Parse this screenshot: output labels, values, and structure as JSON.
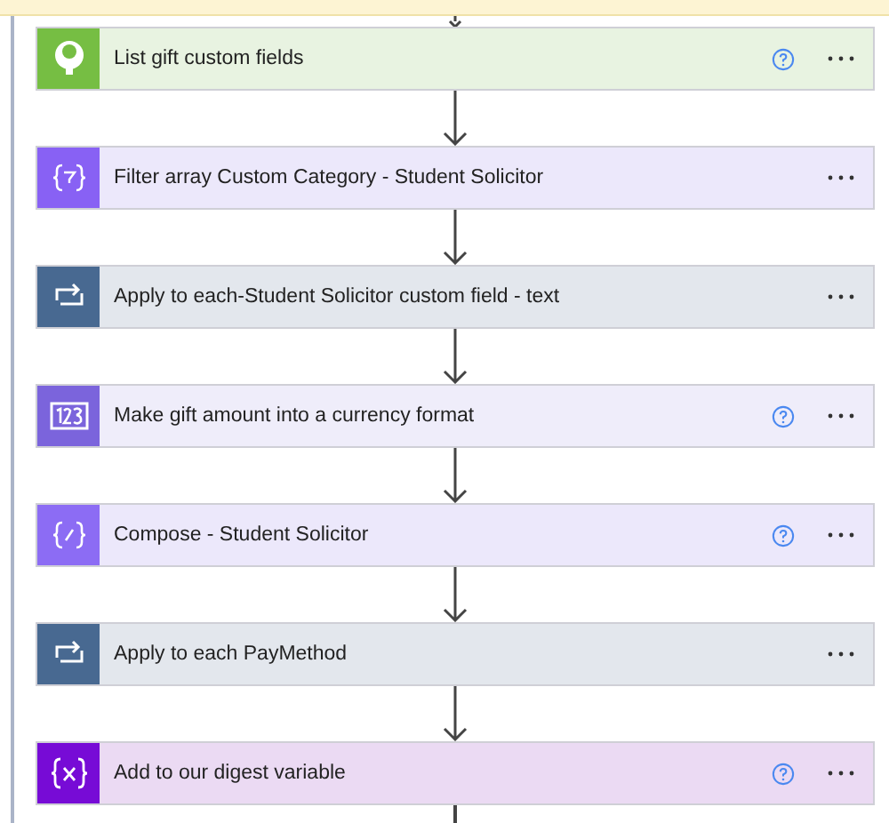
{
  "banner": {
    "kind": "notice"
  },
  "steps": [
    {
      "title": "List gift custom fields",
      "kind": "connector",
      "help": true
    },
    {
      "title": "Filter array Custom Category - Student Solicitor",
      "kind": "filter",
      "help": false
    },
    {
      "title": "Apply to each-Student Solicitor custom field - text",
      "kind": "loop",
      "help": false
    },
    {
      "title": "Make gift amount into a currency format",
      "kind": "number",
      "help": true
    },
    {
      "title": "Compose - Student Solicitor",
      "kind": "compose",
      "help": true
    },
    {
      "title": "Apply to each PayMethod",
      "kind": "loop",
      "help": false
    },
    {
      "title": "Add to our digest variable",
      "kind": "variable",
      "help": true
    }
  ]
}
